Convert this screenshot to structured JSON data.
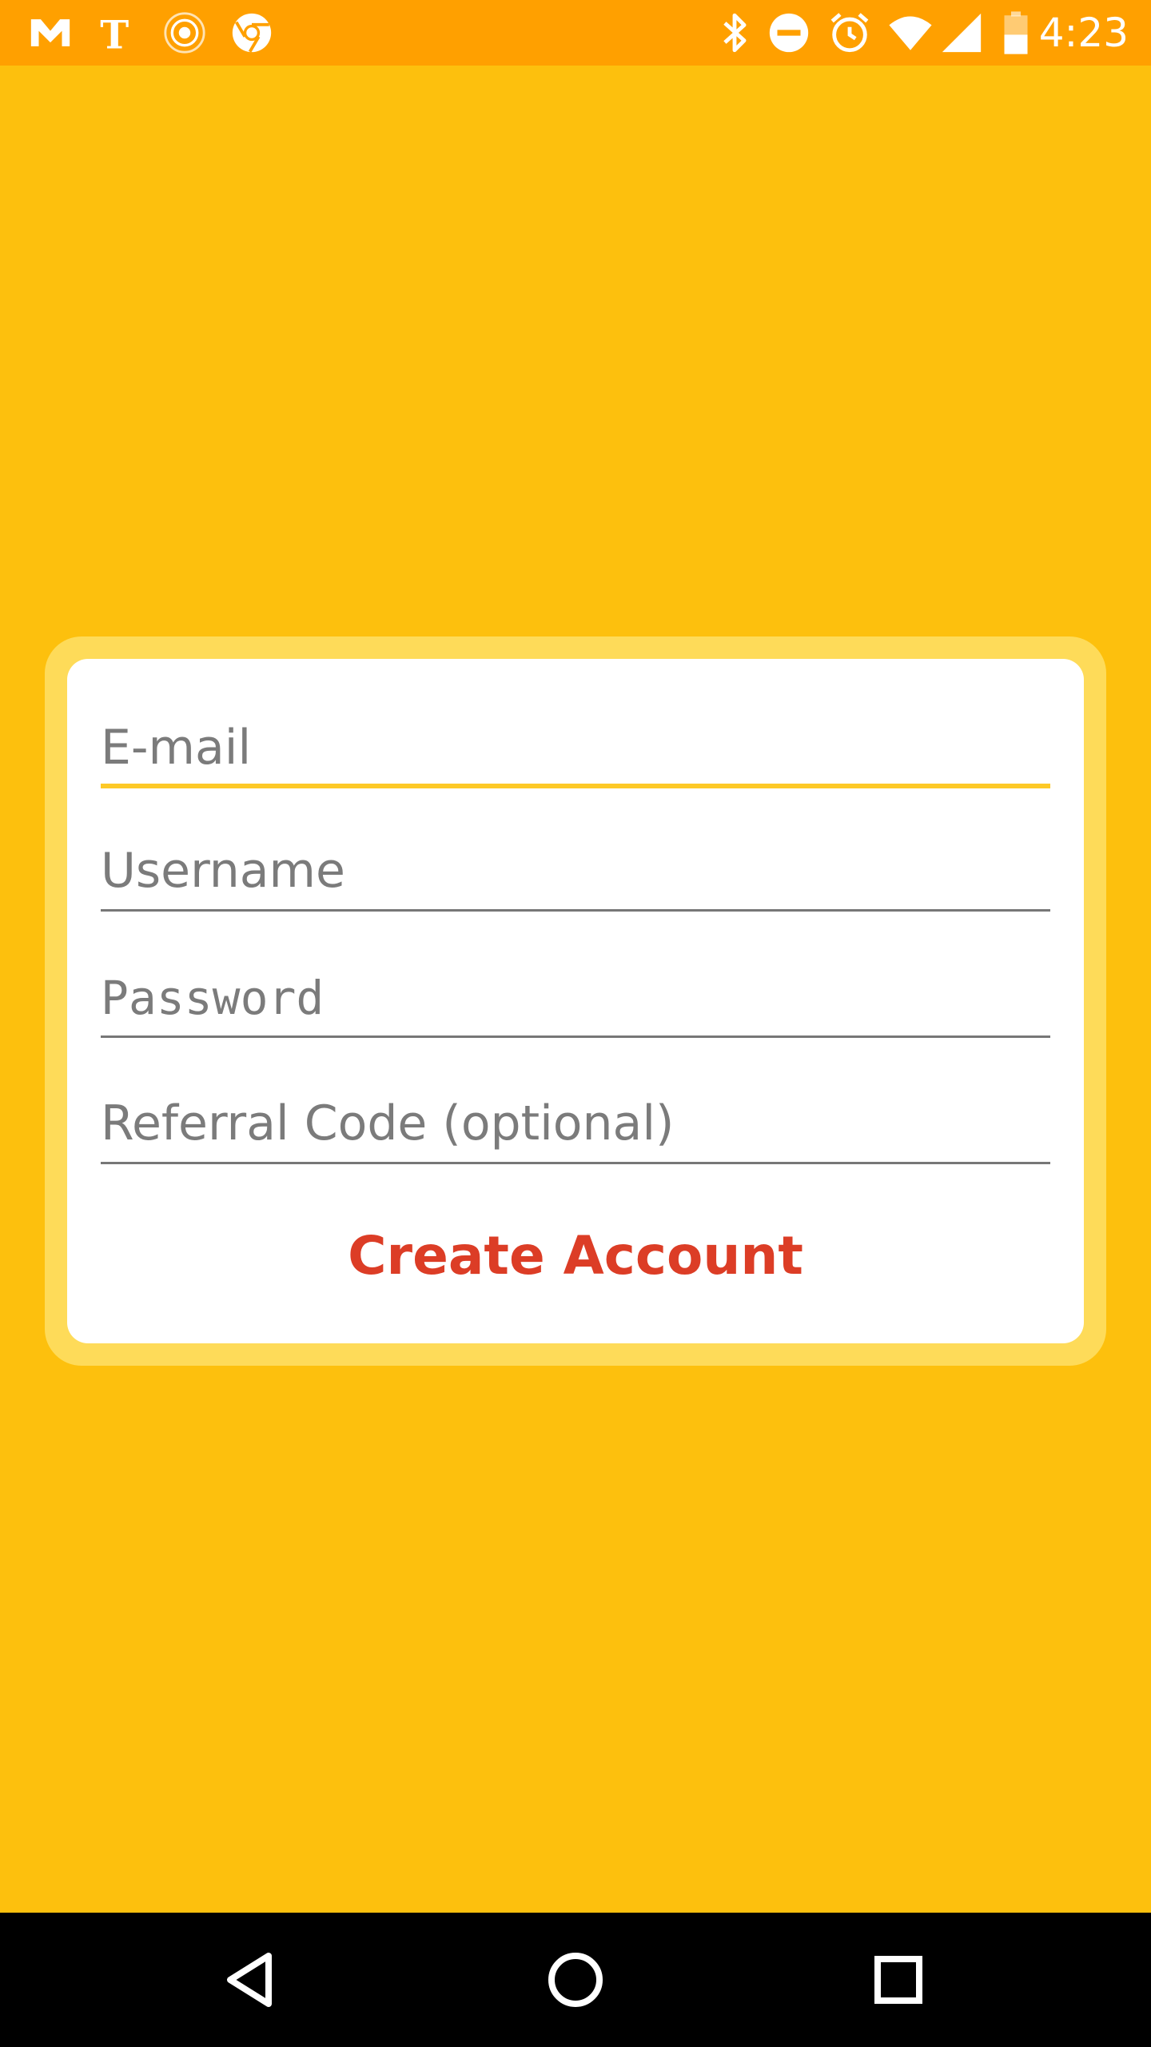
{
  "status_bar": {
    "time": "4:23",
    "left_icons": [
      "gmail-icon",
      "nytimes-icon",
      "radar-icon",
      "chrome-icon"
    ],
    "right_icons": [
      "bluetooth-icon",
      "do-not-disturb-icon",
      "alarm-icon",
      "wifi-icon",
      "signal-icon",
      "battery-icon"
    ]
  },
  "form": {
    "email_placeholder": "E-mail",
    "username_placeholder": "Username",
    "password_placeholder": "Password",
    "referral_placeholder": "Referral Code (optional)",
    "submit_label": "Create Account"
  },
  "colors": {
    "background": "#fdc00d",
    "status_bar": "#ffa000",
    "card_border": "#fedb59",
    "focused_underline": "#fdc927",
    "button_text": "#dc3d26"
  },
  "nav_bar": {
    "buttons": [
      "back-icon",
      "home-icon",
      "recents-icon"
    ]
  }
}
